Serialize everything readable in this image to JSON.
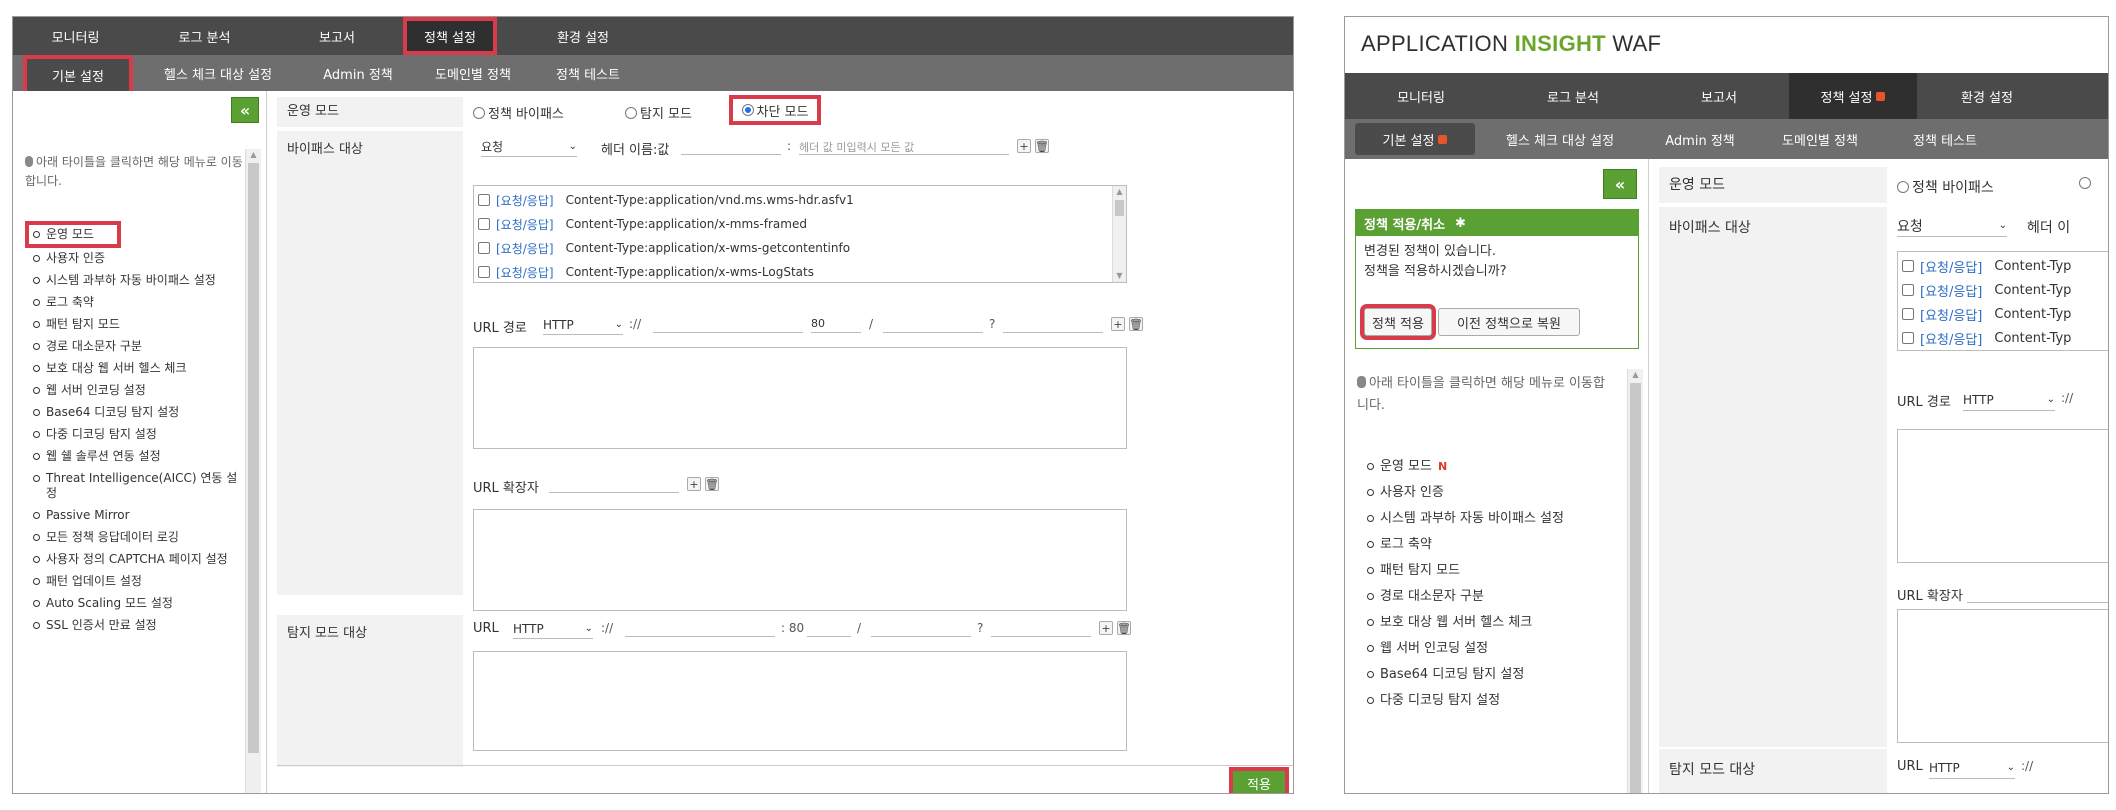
{
  "left": {
    "top_nav": [
      "모니터링",
      "로그 분석",
      "보고서",
      "정책 설정",
      "환경 설정"
    ],
    "sub_nav": [
      "기본 설정",
      "헬스 체크 대상 설정",
      "Admin 정책",
      "도메인별 정책",
      "정책 테스트"
    ],
    "collapse_label": "«",
    "hint": "아래 타이틀을 클릭하면 해당 메뉴로 이동합니다.",
    "menu": [
      "운영 모드",
      "사용자 인증",
      "시스템 과부하 자동 바이패스 설정",
      "로그 축약",
      "패턴 탐지 모드",
      "경로 대소문자 구분",
      "보호 대상 웹 서버 헬스 체크",
      "웹 서버 인코딩 설정",
      "Base64 디코딩 탐지 설정",
      "다중 디코딩 탐지 설정",
      "웹 쉘 솔루션 연동 설정",
      "Threat Intelligence(AICC) 연동 설정",
      "Passive Mirror",
      "모든 정책 응답데이터 로깅",
      "사용자 정의 CAPTCHA 페이지 설정",
      "패턴 업데이트 설정",
      "Auto Scaling 모드 설정",
      "SSL 인증서 만료 설정"
    ],
    "labels": {
      "mode": "운영 모드",
      "bypass": "바이패스 대상",
      "detect": "탐지 모드 대상"
    },
    "radios": [
      "정책 바이패스",
      "탐지 모드",
      "차단 모드"
    ],
    "bypass": {
      "select": "요청",
      "header_label": "헤더 이름:값",
      "colon": ":",
      "placeholder": "헤더 값 미입력시 모든 값",
      "rows": [
        {
          "tag": "[요청/응답]",
          "value": "Content-Type:application/vnd.ms.wms-hdr.asfv1"
        },
        {
          "tag": "[요청/응답]",
          "value": "Content-Type:application/x-mms-framed"
        },
        {
          "tag": "[요청/응답]",
          "value": "Content-Type:application/x-wms-getcontentinfo"
        },
        {
          "tag": "[요청/응답]",
          "value": "Content-Type:application/x-wms-LogStats"
        }
      ]
    },
    "url_path": {
      "label": "URL 경로",
      "scheme": "HTTP",
      "sep": "://",
      "port": "80",
      "slash": "/",
      "q": "?"
    },
    "url_ext": {
      "label": "URL 확장자"
    },
    "detect_url": {
      "label": "URL",
      "scheme": "HTTP",
      "sep": "://",
      "port": ": 80",
      "slash": "/",
      "q": "?"
    },
    "apply": "적용"
  },
  "right": {
    "logo_a": "APPLICATION",
    "logo_b": "INSIGHT",
    "logo_c": "WAF",
    "top_nav": [
      "모니터링",
      "로그 분석",
      "보고서",
      "정책 설정",
      "환경 설정"
    ],
    "sub_nav": [
      "기본 설정",
      "헬스 체크 대상 설정",
      "Admin 정책",
      "도메인별 정책",
      "정책 테스트"
    ],
    "collapse_label": "«",
    "policy_title": "정책 적용/취소",
    "policy_msg1": "변경된 정책이 있습니다.",
    "policy_msg2": "정책을 적용하시겠습니까?",
    "btn_apply": "정책 적용",
    "btn_restore": "이전 정책으로 복원",
    "hint": "아래 타이틀을 클릭하면 해당 메뉴로 이동합니다.",
    "menu": [
      "운영 모드",
      "사용자 인증",
      "시스템 과부하 자동 바이패스 설정",
      "로그 축약",
      "패턴 탐지 모드",
      "경로 대소문자 구분",
      "보호 대상 웹 서버 헬스 체크",
      "웹 서버 인코딩 설정",
      "Base64 디코딩 탐지 설정",
      "다중 디코딩 탐지 설정"
    ],
    "new_mark": "N",
    "labels": {
      "mode": "운영 모드",
      "bypass": "바이패스 대상",
      "detect": "탐지 모드 대상"
    },
    "radio": "정책 바이패스",
    "select": "요청",
    "header_label": "헤더 이",
    "rows": [
      {
        "tag": "[요청/응답]",
        "value": "Content-Typ"
      },
      {
        "tag": "[요청/응답]",
        "value": "Content-Typ"
      },
      {
        "tag": "[요청/응답]",
        "value": "Content-Typ"
      },
      {
        "tag": "[요청/응답]",
        "value": "Content-Typ"
      }
    ],
    "url_path": {
      "label": "URL 경로",
      "scheme": "HTTP",
      "sep": "://"
    },
    "url_ext": {
      "label": "URL 확장자"
    },
    "detect_url": {
      "label": "URL",
      "scheme": "HTTP",
      "sep": "://"
    }
  },
  "colors": {
    "nav_dark": "#4a4a4a",
    "nav_sub": "#6e6e6e",
    "accent_green": "#5aa032",
    "highlight_red": "#d83b4a",
    "link_blue": "#2b6cc4"
  }
}
